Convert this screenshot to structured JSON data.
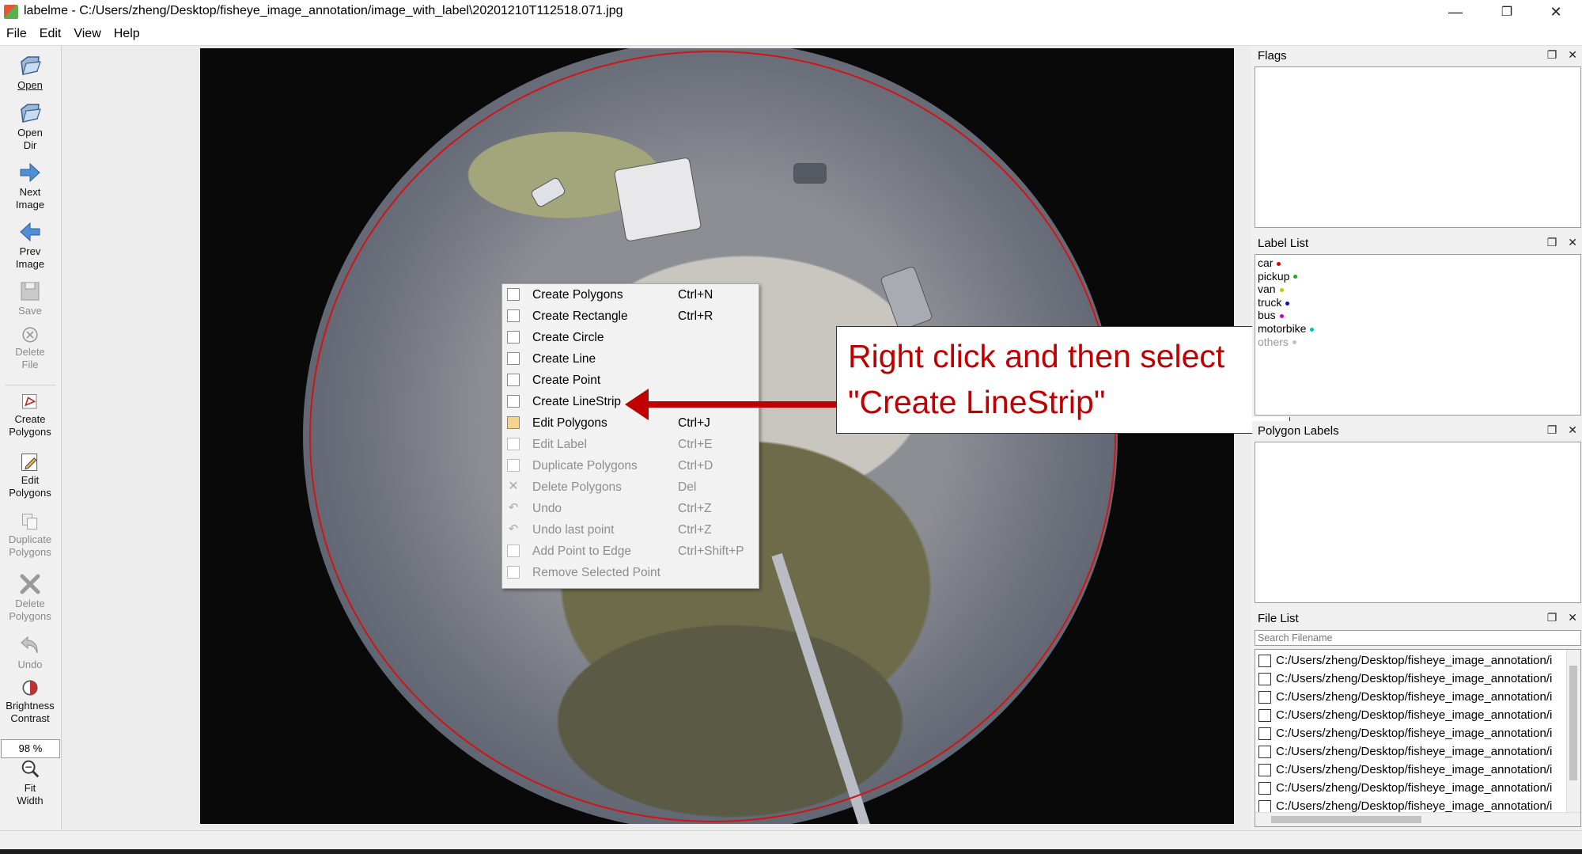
{
  "window": {
    "title": "labelme - C:/Users/zheng/Desktop/fisheye_image_annotation/image_with_label\\20201210T112518.071.jpg",
    "minimize": "—",
    "restore": "❐",
    "close": "✕"
  },
  "menubar": {
    "items": [
      "File",
      "Edit",
      "View",
      "Help"
    ]
  },
  "toolbar": {
    "open": "Open",
    "open_dir_1": "Open",
    "open_dir_2": "Dir",
    "next_1": "Next",
    "next_2": "Image",
    "prev_1": "Prev",
    "prev_2": "Image",
    "save": "Save",
    "delete_1": "Delete",
    "delete_2": "File",
    "create_1": "Create",
    "create_2": "Polygons",
    "edit_1": "Edit",
    "edit_2": "Polygons",
    "dup_1": "Duplicate",
    "dup_2": "Polygons",
    "del_poly_1": "Delete",
    "del_poly_2": "Polygons",
    "undo": "Undo",
    "bright_1": "Brightness",
    "bright_2": "Contrast",
    "zoom": "98 %",
    "fit_1": "Fit",
    "fit_2": "Width"
  },
  "context_menu": {
    "items": [
      {
        "label": "Create Polygons",
        "shortcut": "Ctrl+N",
        "enabled": true
      },
      {
        "label": "Create Rectangle",
        "shortcut": "Ctrl+R",
        "enabled": true
      },
      {
        "label": "Create Circle",
        "shortcut": "",
        "enabled": true
      },
      {
        "label": "Create Line",
        "shortcut": "",
        "enabled": true
      },
      {
        "label": "Create Point",
        "shortcut": "",
        "enabled": true
      },
      {
        "label": "Create LineStrip",
        "shortcut": "",
        "enabled": true
      },
      {
        "label": "Edit Polygons",
        "shortcut": "Ctrl+J",
        "enabled": true
      },
      {
        "label": "Edit Label",
        "shortcut": "Ctrl+E",
        "enabled": false
      },
      {
        "label": "Duplicate Polygons",
        "shortcut": "Ctrl+D",
        "enabled": false
      },
      {
        "label": "Delete Polygons",
        "shortcut": "Del",
        "enabled": false
      },
      {
        "label": "Undo",
        "shortcut": "Ctrl+Z",
        "enabled": false
      },
      {
        "label": "Undo last point",
        "shortcut": "Ctrl+Z",
        "enabled": false
      },
      {
        "label": "Add Point to Edge",
        "shortcut": "Ctrl+Shift+P",
        "enabled": false
      },
      {
        "label": "Remove Selected Point",
        "shortcut": "",
        "enabled": false
      }
    ]
  },
  "annotation": {
    "line1": "Right click and then select",
    "line2": "\"Create LineStrip\"",
    "color": "#c00000"
  },
  "docks": {
    "flags": {
      "title": "Flags"
    },
    "label_list": {
      "title": "Label List",
      "labels": [
        {
          "name": "car",
          "color": "#e00000"
        },
        {
          "name": "pickup",
          "color": "#00c000"
        },
        {
          "name": "van",
          "color": "#c8c800"
        },
        {
          "name": "truck",
          "color": "#0000d0"
        },
        {
          "name": "bus",
          "color": "#c000c0"
        },
        {
          "name": "motorbike",
          "color": "#00c0c0"
        },
        {
          "name": "others",
          "color": "#c0c0c0"
        }
      ]
    },
    "polygon_labels": {
      "title": "Polygon Labels"
    },
    "file_list": {
      "title": "File List",
      "search_placeholder": "Search Filename",
      "files": [
        "C:/Users/zheng/Desktop/fisheye_image_annotation/i",
        "C:/Users/zheng/Desktop/fisheye_image_annotation/i",
        "C:/Users/zheng/Desktop/fisheye_image_annotation/i",
        "C:/Users/zheng/Desktop/fisheye_image_annotation/i",
        "C:/Users/zheng/Desktop/fisheye_image_annotation/i",
        "C:/Users/zheng/Desktop/fisheye_image_annotation/i",
        "C:/Users/zheng/Desktop/fisheye_image_annotation/i",
        "C:/Users/zheng/Desktop/fisheye_image_annotation/i",
        "C:/Users/zheng/Desktop/fisheye_image_annotation/i"
      ]
    }
  }
}
